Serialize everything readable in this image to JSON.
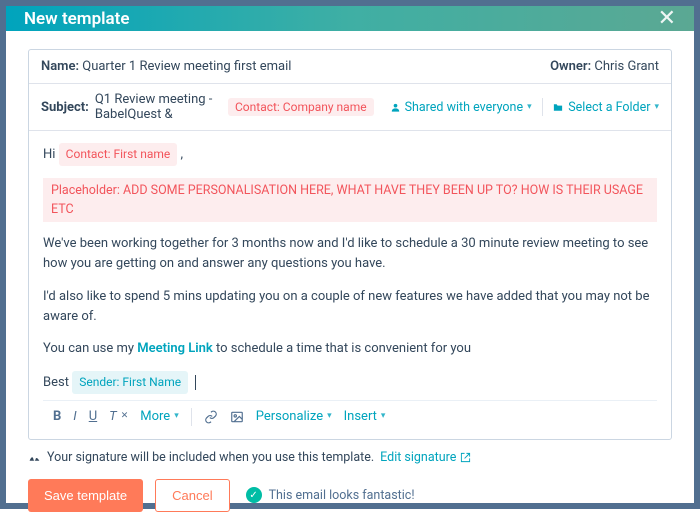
{
  "header": {
    "title": "New template"
  },
  "meta": {
    "name_label": "Name:",
    "name_value": "Quarter 1 Review meeting first email",
    "owner_label": "Owner:",
    "owner_value": "Chris Grant"
  },
  "subject": {
    "label": "Subject:",
    "text": "Q1 Review meeting - BabelQuest &",
    "token": "Contact: Company name",
    "sharing": "Shared with everyone",
    "folder": "Select a Folder"
  },
  "body": {
    "greeting_pre": "Hi",
    "greeting_token": "Contact: First name",
    "greeting_post": ",",
    "placeholder": "Placeholder: ADD SOME PERSONALISATION HERE, WHAT HAVE THEY BEEN UP TO? HOW IS THEIR USAGE ETC",
    "p1": "We've been working together for 3 months now and I'd like to schedule a 30 minute review meeting to see how you are getting on and answer any questions you have.",
    "p2": "I'd also like to spend 5 mins updating you on a couple of new features we have added that you may not be aware of.",
    "p3_pre": "You can use my ",
    "p3_link": "Meeting Link",
    "p3_post": " to schedule a time that is convenient for you",
    "signoff_pre": "Best",
    "signoff_token": "Sender: First Name"
  },
  "toolbar": {
    "more": "More",
    "personalize": "Personalize",
    "insert": "Insert"
  },
  "signature": {
    "text": "Your signature will be included when you use this template.",
    "link": "Edit signature"
  },
  "footer": {
    "save": "Save template",
    "cancel": "Cancel",
    "status": "This email looks fantastic!"
  }
}
